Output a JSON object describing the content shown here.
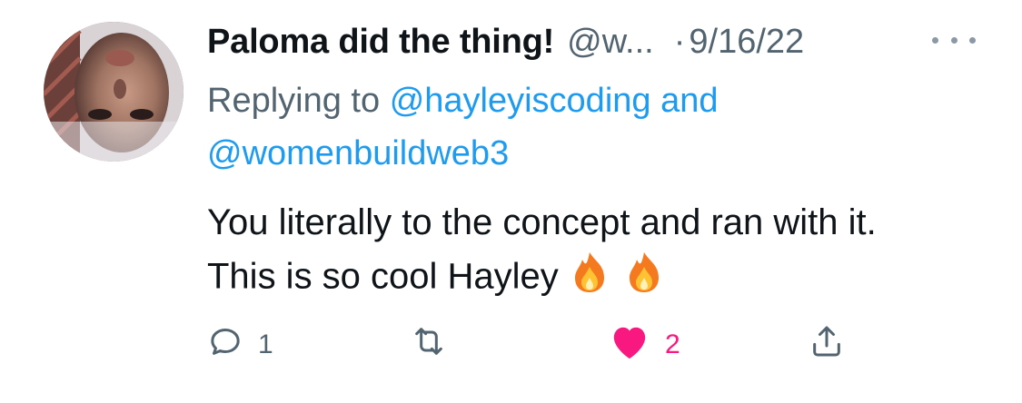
{
  "tweet": {
    "display_name": "Paloma did the thing!",
    "handle": "@w...",
    "separator": "·",
    "date": "9/16/22",
    "reply_prefix": "Replying to",
    "mention_1": "@hayleyiscoding",
    "conjunction": "and",
    "mention_2": "@womenbuildweb3",
    "line_1": "You literally to the concept and ran with it.",
    "line_2": "This is so cool Hayley",
    "emoji": "🔥🔥"
  },
  "actions": {
    "reply_count": "1",
    "retweet_count": "",
    "like_count": "2"
  },
  "colors": {
    "text": "#0f1419",
    "secondary": "#536471",
    "link": "#1d9bf0",
    "like": "#f91880"
  },
  "icons": {
    "reply": "reply-icon",
    "retweet": "retweet-icon",
    "like": "heart-icon",
    "share": "share-icon",
    "more": "more-icon",
    "fire": "fire-emoji"
  }
}
